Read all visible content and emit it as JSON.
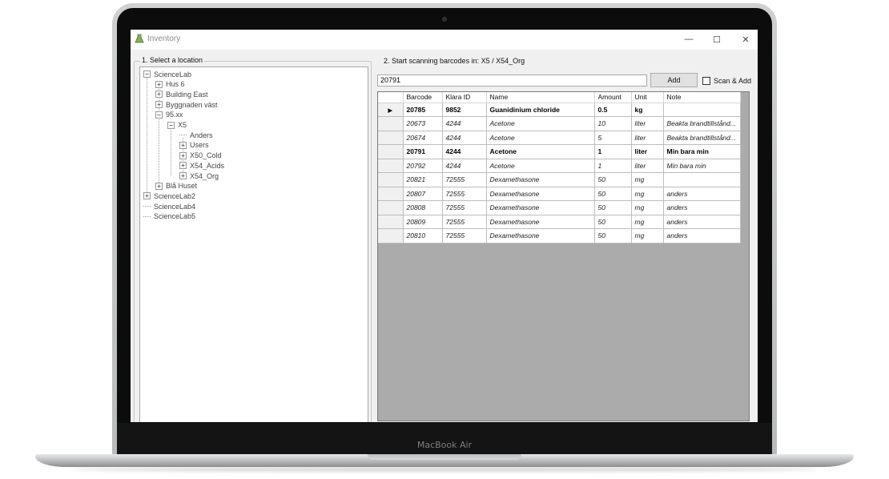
{
  "device": {
    "brand": "MacBook Air"
  },
  "window": {
    "title": "Inventory",
    "controls": {
      "minimize": "—",
      "maximize": "☐",
      "close": "✕"
    }
  },
  "location_panel": {
    "title": "1. Select a location",
    "tree": [
      {
        "label": "ScienceLab",
        "expander": "−"
      },
      {
        "label": "Hus 6",
        "expander": "+"
      },
      {
        "label": "Building East",
        "expander": "+"
      },
      {
        "label": "Byggnaden väst",
        "expander": "+"
      },
      {
        "label": "95.xx",
        "expander": "−"
      },
      {
        "label": "X5",
        "expander": "−"
      },
      {
        "label": "Anders",
        "expander": ""
      },
      {
        "label": "Users",
        "expander": "+"
      },
      {
        "label": "X50_Cold",
        "expander": "+"
      },
      {
        "label": "X54_Acids",
        "expander": "+"
      },
      {
        "label": "X54_Org",
        "expander": "+"
      },
      {
        "label": "Blå Huset",
        "expander": "+"
      },
      {
        "label": "ScienceLab2",
        "expander": "+"
      },
      {
        "label": "ScienceLab4",
        "expander": ""
      },
      {
        "label": "ScienceLab5",
        "expander": ""
      }
    ]
  },
  "scan_panel": {
    "title": "2. Start scanning barcodes in: X5 / X54_Org",
    "barcode_value": "20791",
    "add_label": "Add",
    "scan_add_label": "Scan & Add",
    "scan_add_checked": false
  },
  "grid": {
    "columns": [
      "Barcode",
      "Klara ID",
      "Name",
      "Amount",
      "Unit",
      "Note"
    ],
    "current_row_marker": "▶",
    "rows": [
      {
        "cells": [
          "20785",
          "9852",
          "Guanidinium chloride",
          "0.5",
          "kg",
          ""
        ],
        "bold": true,
        "current": true
      },
      {
        "cells": [
          "20673",
          "4244",
          "Acetone",
          "10",
          "liter",
          "Beakta brandtillstånd..."
        ],
        "bold": false,
        "current": false
      },
      {
        "cells": [
          "20674",
          "4244",
          "Acetone",
          "5",
          "liter",
          "Beakta brandtillstånd..."
        ],
        "bold": false,
        "current": false
      },
      {
        "cells": [
          "20791",
          "4244",
          "Acetone",
          "1",
          "liter",
          "Min bara min"
        ],
        "bold": true,
        "current": false
      },
      {
        "cells": [
          "20792",
          "4244",
          "Acetone",
          "1",
          "liter",
          "Min bara min"
        ],
        "bold": false,
        "current": false
      },
      {
        "cells": [
          "20821",
          "72555",
          "Dexamethasone",
          "50",
          "mg",
          ""
        ],
        "bold": false,
        "current": false
      },
      {
        "cells": [
          "20807",
          "72555",
          "Dexamethasone",
          "50",
          "mg",
          "anders"
        ],
        "bold": false,
        "current": false
      },
      {
        "cells": [
          "20808",
          "72555",
          "Dexamethasone",
          "50",
          "mg",
          "anders"
        ],
        "bold": false,
        "current": false
      },
      {
        "cells": [
          "20809",
          "72555",
          "Dexamethasone",
          "50",
          "mg",
          "anders"
        ],
        "bold": false,
        "current": false
      },
      {
        "cells": [
          "20810",
          "72555",
          "Dexamethasone",
          "50",
          "mg",
          "anders"
        ],
        "bold": false,
        "current": false
      }
    ]
  }
}
